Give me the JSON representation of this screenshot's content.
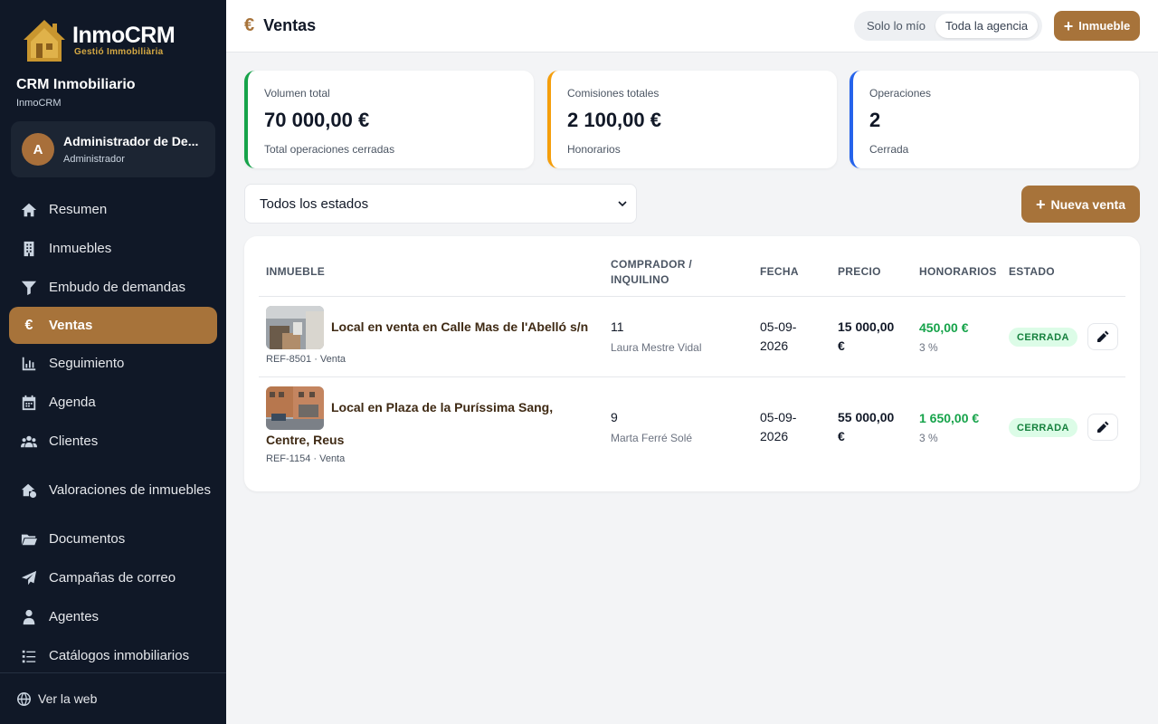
{
  "brand": {
    "name": "InmoCRM",
    "tagline": "Gestió Immobiliària"
  },
  "org": {
    "title": "CRM Inmobiliario",
    "subtitle": "InmoCRM"
  },
  "user": {
    "initial": "A",
    "name": "Administrador de De...",
    "role": "Administrador"
  },
  "nav": [
    {
      "label": "Resumen",
      "icon": "home-icon"
    },
    {
      "label": "Inmuebles",
      "icon": "building-icon"
    },
    {
      "label": "Embudo de demandas",
      "icon": "funnel-icon"
    },
    {
      "label": "Ventas",
      "icon": "euro-icon",
      "active": true
    },
    {
      "label": "Seguimiento",
      "icon": "chart-icon"
    },
    {
      "label": "Agenda",
      "icon": "calendar-icon"
    },
    {
      "label": "Clientes",
      "icon": "users-icon"
    },
    {
      "label": "Valoraciones de inmuebles",
      "icon": "house-check-icon"
    },
    {
      "label": "Documentos",
      "icon": "folder-icon"
    },
    {
      "label": "Campañas de correo",
      "icon": "send-icon"
    },
    {
      "label": "Agentes",
      "icon": "user-tie-icon"
    },
    {
      "label": "Catálogos inmobiliarios",
      "icon": "list-icon"
    }
  ],
  "footer": {
    "link": "Ver la web"
  },
  "header": {
    "euro": "€",
    "title": "Ventas",
    "scope_mine": "Solo lo mío",
    "scope_all": "Toda la agencia",
    "add_property": "Inmueble"
  },
  "stats": [
    {
      "label": "Volumen total",
      "value": "70 000,00 €",
      "sub": "Total operaciones cerradas",
      "color": "#16a34a"
    },
    {
      "label": "Comisiones totales",
      "value": "2 100,00 €",
      "sub": "Honorarios",
      "color": "#f59e0b"
    },
    {
      "label": "Operaciones",
      "value": "2",
      "sub": "Cerrada",
      "color": "#2563eb"
    }
  ],
  "filter": {
    "status_selected": "Todos los estados"
  },
  "new_sale": "Nueva venta",
  "table": {
    "headers": {
      "property": "INMUEBLE",
      "buyer_line1": "COMPRADOR /",
      "buyer_line2": "INQUILINO",
      "date": "FECHA",
      "price": "PRECIO",
      "fees": "HONORARIOS",
      "status": "ESTADO"
    },
    "rows": [
      {
        "title_line1": "Local en venta en Calle Mas de l'Abelló s/n",
        "title_line2": "",
        "ref": "REF-8501 · Venta",
        "buyer_id": "11",
        "buyer_name": "Laura Mestre Vidal",
        "date_line1": "05-09-",
        "date_line2": "2026",
        "price_line1": "15 000,00",
        "price_line2": "€",
        "fee": "450,00 €",
        "fee_pct": "3 %",
        "status": "CERRADA"
      },
      {
        "title_line1": "Local en Plaza de la Puríssima Sang,",
        "title_line2": "Centre, Reus",
        "ref": "REF-1154 · Venta",
        "buyer_id": "9",
        "buyer_name": "Marta Ferré Solé",
        "date_line1": "05-09-",
        "date_line2": "2026",
        "price_line1": "55 000,00",
        "price_line2": "€",
        "fee": "1 650,00 €",
        "fee_pct": "3 %",
        "status": "CERRADA"
      }
    ]
  }
}
